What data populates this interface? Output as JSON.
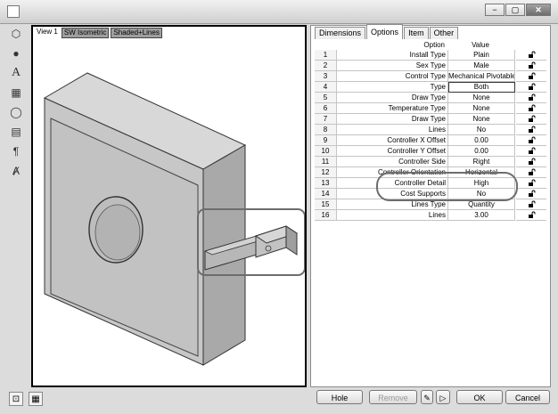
{
  "window": {
    "controls": [
      "−",
      "▢",
      "✕"
    ]
  },
  "view": {
    "tabs": [
      "View 1",
      "SW Isometric",
      "Shaded+Lines"
    ]
  },
  "properties": {
    "tabs": [
      "Dimensions",
      "Options",
      "Item",
      "Other"
    ],
    "active_tab": "Options",
    "columns": {
      "option": "Option",
      "value": "Value"
    },
    "rows": [
      {
        "num": "1",
        "option": "Install Type",
        "value": "Plain"
      },
      {
        "num": "2",
        "option": "Sex Type",
        "value": "Male"
      },
      {
        "num": "3",
        "option": "Control Type",
        "value": "Mechanical Pivotable"
      },
      {
        "num": "4",
        "option": "Type",
        "value": "Both"
      },
      {
        "num": "5",
        "option": "Draw Type",
        "value": "None"
      },
      {
        "num": "6",
        "option": "Temperature Type",
        "value": "None"
      },
      {
        "num": "7",
        "option": "Draw Type",
        "value": "None"
      },
      {
        "num": "8",
        "option": "Lines",
        "value": "No"
      },
      {
        "num": "9",
        "option": "Controller X Offset",
        "value": "0.00"
      },
      {
        "num": "10",
        "option": "Controller Y Offset",
        "value": "0.00"
      },
      {
        "num": "11",
        "option": "Controller Side",
        "value": "Right"
      },
      {
        "num": "12",
        "option": "Controller Orientation",
        "value": "Horizontal"
      },
      {
        "num": "13",
        "option": "Controller Detail",
        "value": "High"
      },
      {
        "num": "14",
        "option": "Cost Supports",
        "value": "No"
      },
      {
        "num": "15",
        "option": "Lines Type",
        "value": "Quantity"
      },
      {
        "num": "16",
        "option": "Lines",
        "value": "3.00"
      }
    ]
  },
  "buttons": {
    "hole": "Hole",
    "remove": "Remove",
    "ok": "OK",
    "cancel": "Cancel"
  }
}
